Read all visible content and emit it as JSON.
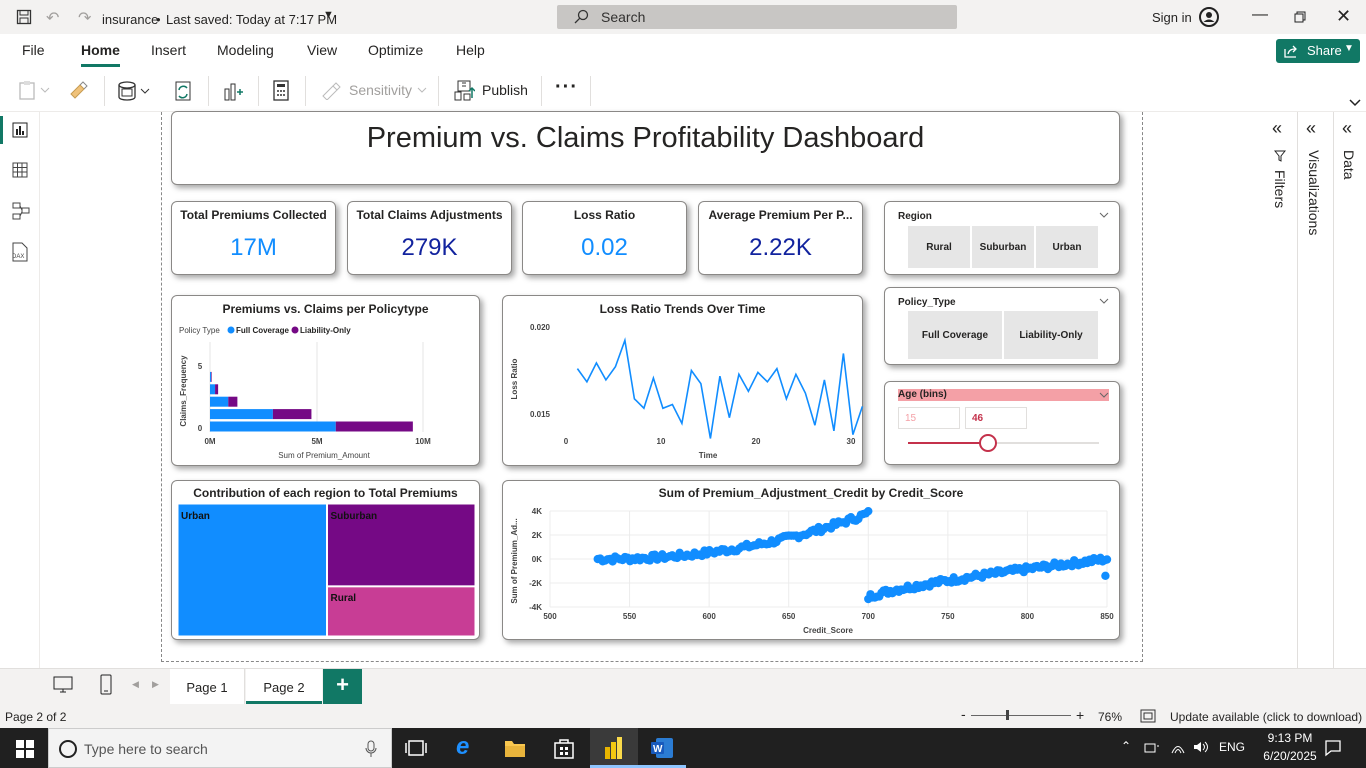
{
  "titlebar": {
    "file_name": "insurance",
    "saved_status": "Last saved: Today at 7:17 PM",
    "search_placeholder": "Search",
    "sign_in": "Sign in"
  },
  "menu": {
    "items": [
      "File",
      "Home",
      "Insert",
      "Modeling",
      "View",
      "Optimize",
      "Help"
    ],
    "active": "Home",
    "share": "Share"
  },
  "ribbon": {
    "sensitivity": "Sensitivity",
    "publish": "Publish",
    "more": "···"
  },
  "panes": {
    "filters": "Filters",
    "visualizations": "Visualizations",
    "data": "Data"
  },
  "report": {
    "title": "Premium vs. Claims Profitability Dashboard",
    "kpis": [
      {
        "title": "Total Premiums Collected",
        "value": "17M",
        "color": "#118dff"
      },
      {
        "title": "Total Claims Adjustments",
        "value": "279K",
        "color": "#12239e"
      },
      {
        "title": "Loss Ratio",
        "value": "0.02",
        "color": "#118dff"
      },
      {
        "title": "Average Premium Per P...",
        "value": "2.22K",
        "color": "#12239e"
      }
    ],
    "slicer_region": {
      "title": "Region",
      "options": [
        "Rural",
        "Suburban",
        "Urban"
      ]
    },
    "slicer_policy": {
      "title": "Policy_Type",
      "options": [
        "Full Coverage",
        "Liability-Only"
      ]
    },
    "slicer_age": {
      "title": "Age (bins)",
      "min": "15",
      "max": "46",
      "fraction": 0.42
    }
  },
  "chart_data": [
    {
      "type": "bar",
      "orientation": "horizontal-stacked",
      "title": "Premiums vs. Claims per Policytype",
      "legend_title": "Policy Type",
      "legend_position": "top-left",
      "xlabel": "Sum of Premium_Amount",
      "ylabel": "Claims_Frequency",
      "x_ticks": [
        "0M",
        "5M",
        "10M"
      ],
      "y_ticks": [
        "0",
        "5"
      ],
      "xlim": [
        0,
        10500000
      ],
      "categories": [
        0,
        1,
        2,
        3,
        4
      ],
      "series": [
        {
          "name": "Full Coverage",
          "color": "#118dff",
          "values": [
            6200000,
            3100000,
            900000,
            250000,
            50000
          ]
        },
        {
          "name": "Liability-Only",
          "color": "#750985",
          "values": [
            3800000,
            1900000,
            450000,
            150000,
            30000
          ]
        }
      ]
    },
    {
      "type": "line",
      "title": "Loss Ratio Trends Over Time",
      "xlabel": "Time",
      "ylabel": "Loss Ratio",
      "x_ticks": [
        "0",
        "10",
        "20",
        "30"
      ],
      "y_ticks": [
        "0.015",
        "0.020"
      ],
      "xlim": [
        -0.5,
        30.5
      ],
      "ylim": [
        0.0137,
        0.0208
      ],
      "color": "#118dff",
      "x": [
        1,
        2,
        3,
        4,
        5,
        6,
        7,
        8,
        9,
        10,
        11,
        12,
        13,
        14,
        15,
        16,
        17,
        18,
        19,
        20,
        21,
        22,
        23,
        24,
        25,
        26,
        27,
        28,
        29,
        30
      ],
      "y": [
        0.0178,
        0.0171,
        0.0181,
        0.0172,
        0.0179,
        0.0193,
        0.0162,
        0.0157,
        0.0173,
        0.0157,
        0.0159,
        0.0149,
        0.0177,
        0.017,
        0.0141,
        0.0174,
        0.0152,
        0.0175,
        0.0166,
        0.0176,
        0.0171,
        0.0178,
        0.0162,
        0.0175,
        0.0165,
        0.0148,
        0.0172,
        0.0145,
        0.0186,
        0.0143,
        0.0158
      ]
    },
    {
      "type": "treemap",
      "title": "Contribution of each region to Total Premiums",
      "items": [
        {
          "name": "Urban",
          "share": 0.5,
          "color": "#118dff"
        },
        {
          "name": "Suburban",
          "share": 0.31,
          "color": "#750985"
        },
        {
          "name": "Rural",
          "share": 0.19,
          "color": "#c83d95"
        }
      ]
    },
    {
      "type": "scatter",
      "title": "Sum of Premium_Adjustment_Credit by Credit_Score",
      "xlabel": "Credit_Score",
      "ylabel": "Sum of Premium_Ad...",
      "x_ticks": [
        "500",
        "550",
        "600",
        "650",
        "700",
        "750",
        "800",
        "850"
      ],
      "y_ticks": [
        "4K",
        "2K",
        "0K",
        "-2K",
        "-4K"
      ],
      "xlim": [
        500,
        850
      ],
      "ylim": [
        -4000,
        4000
      ],
      "color": "#118dff",
      "segments": [
        {
          "x_from": 530,
          "x_to": 700,
          "y_from": 0,
          "y_to": 3800,
          "note": ""
        },
        {
          "x_from": 700,
          "x_to": 850,
          "y_from": -3200,
          "y_to": 0,
          "note": ""
        }
      ]
    }
  ],
  "pages": {
    "tabs": [
      "Page 1",
      "Page 2"
    ],
    "active": "Page 2",
    "add": "+"
  },
  "status": {
    "page_info": "Page 2 of 2",
    "zoom": "76%",
    "update": "Update available (click to download)"
  },
  "taskbar": {
    "search_placeholder": "Type here to search",
    "lang": "ENG",
    "time": "9:13 PM",
    "date": "6/20/2025"
  }
}
